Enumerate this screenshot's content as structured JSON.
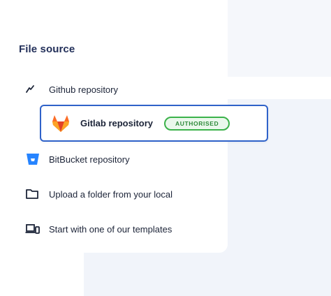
{
  "section_title": "File source",
  "sources": [
    {
      "label": "Github repository",
      "icon": "github-icon"
    },
    {
      "label": "Gitlab repository",
      "icon": "gitlab-icon",
      "selected": true,
      "badge": "AUTHORISED"
    },
    {
      "label": "BitBucket repository",
      "icon": "bitbucket-icon"
    },
    {
      "label": "Upload a folder from your local",
      "icon": "folder-icon"
    },
    {
      "label": "Start with one of our templates",
      "icon": "devices-icon"
    }
  ],
  "colors": {
    "accent_border": "#2f62c9",
    "badge_green": "#3bb24a",
    "gitlab_orange": "#e24329",
    "bitbucket_blue": "#2684ff"
  }
}
